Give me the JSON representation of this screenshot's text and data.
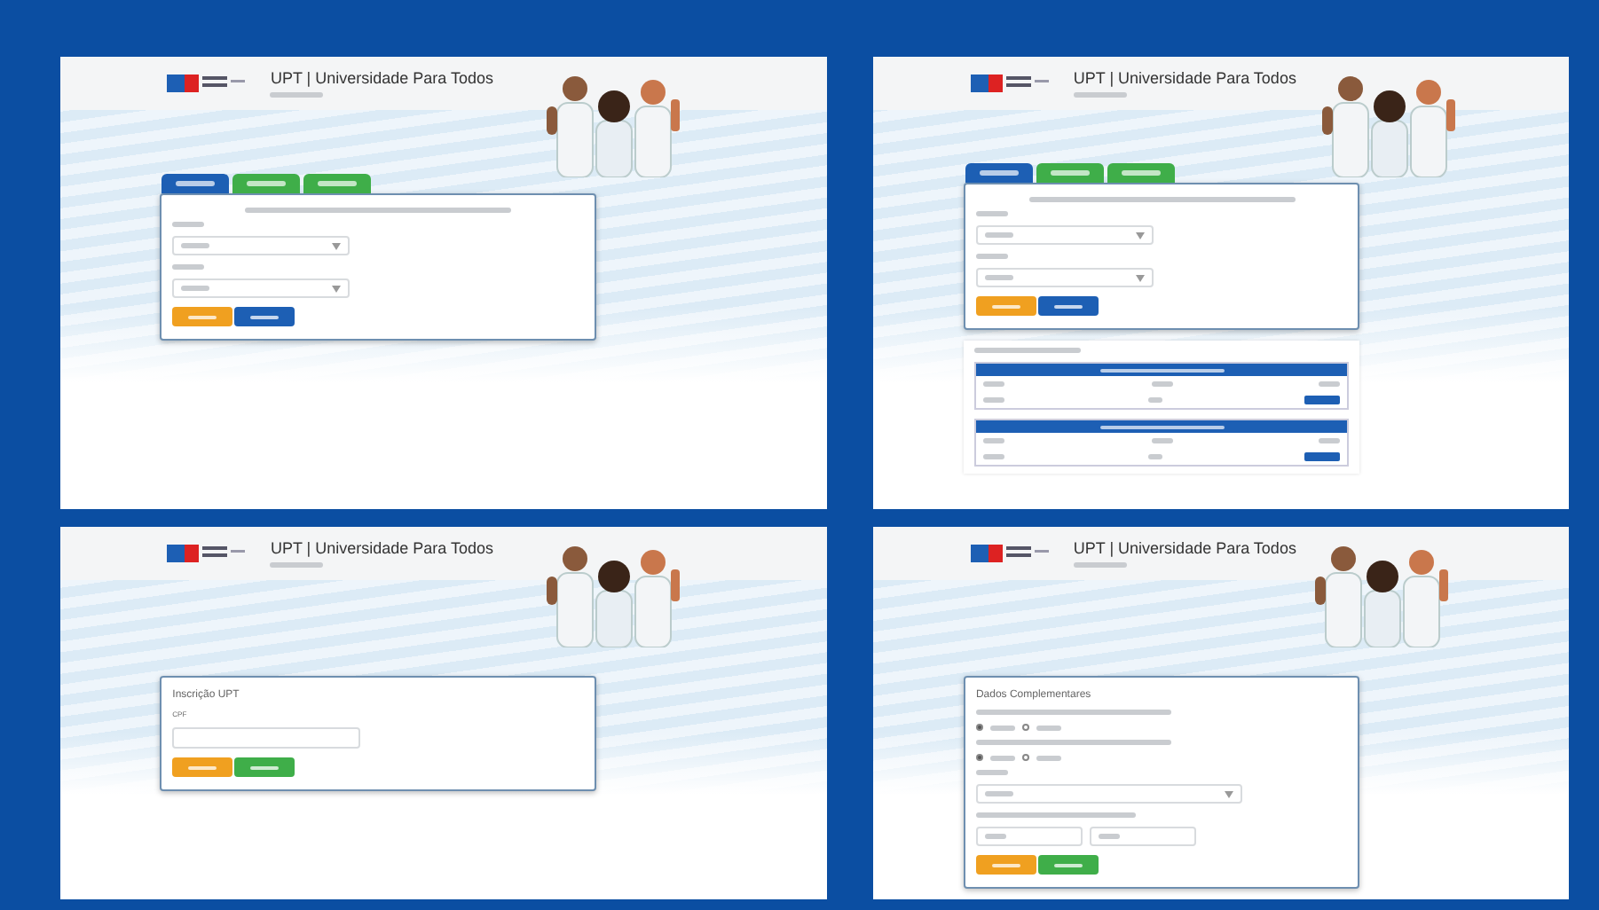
{
  "screens": [
    {
      "kind": "search",
      "title": "UPT | Universidade Para Todos",
      "tabs": [
        {
          "selected": true
        },
        {
          "selected": false
        },
        {
          "selected": false
        }
      ],
      "fields": [
        {
          "kind": "select"
        },
        {
          "kind": "select"
        }
      ],
      "buttons": [
        {
          "kind": "warning"
        },
        {
          "kind": "primary"
        }
      ]
    },
    {
      "kind": "search",
      "title": "UPT | Universidade Para Todos",
      "tabs": [
        {
          "selected": true
        },
        {
          "selected": false
        },
        {
          "selected": false
        }
      ],
      "fields": [
        {
          "kind": "select"
        },
        {
          "kind": "select"
        }
      ],
      "buttons": [
        {
          "kind": "warning"
        },
        {
          "kind": "primary"
        }
      ],
      "results": [
        {
          "kind": "table"
        },
        {
          "kind": "table"
        }
      ]
    },
    {
      "kind": "form",
      "title": "UPT | Universidade Para Todos",
      "heading": "Inscrição UPT",
      "fields": [
        {
          "kind": "text",
          "label": "CPF"
        }
      ],
      "buttons": [
        {
          "kind": "warning"
        },
        {
          "kind": "success"
        }
      ]
    },
    {
      "kind": "form",
      "title": "UPT | Universidade Para Todos",
      "heading": "Dados Complementares",
      "fields": [
        {
          "kind": "radio",
          "options": [
            {
              "selected": true
            },
            {
              "selected": false
            }
          ]
        },
        {
          "kind": "radio",
          "options": [
            {
              "selected": true
            },
            {
              "selected": false
            }
          ]
        },
        {
          "kind": "select"
        },
        {
          "kind": "pair"
        }
      ],
      "buttons": [
        {
          "kind": "warning"
        },
        {
          "kind": "success"
        }
      ]
    }
  ]
}
